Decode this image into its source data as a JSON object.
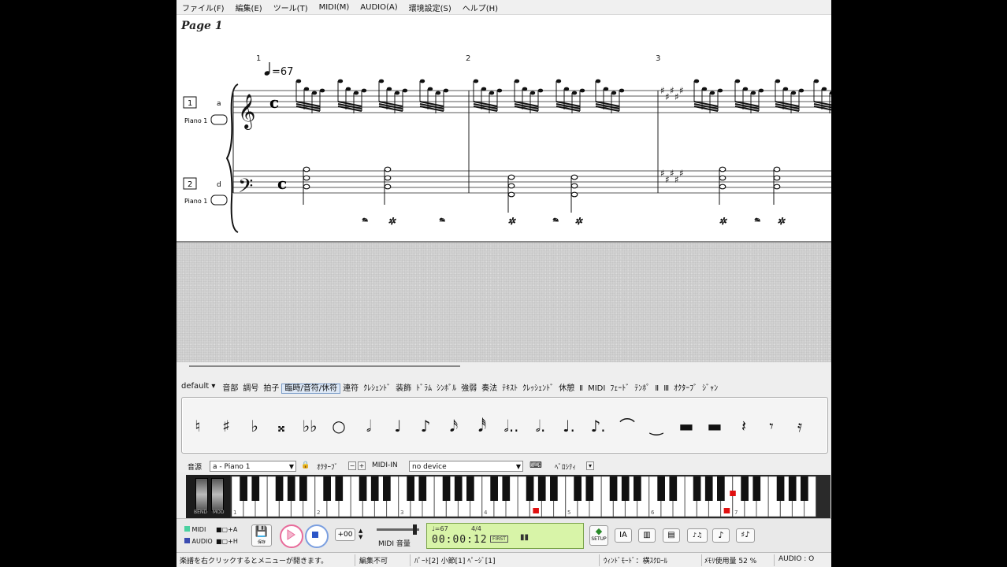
{
  "menu": [
    "ファイル(F)",
    "編集(E)",
    "ツール(T)",
    "MIDI(M)",
    "AUDIO(A)",
    "環境設定(S)",
    "ヘルプ(H)"
  ],
  "score": {
    "page_label": "Page 1",
    "tempo": "=67",
    "measure_numbers": [
      "1",
      "2",
      "3"
    ],
    "staves": [
      {
        "number": "1",
        "key_label": "a",
        "instrument": "Piano 1"
      },
      {
        "number": "2",
        "key_label": "d",
        "instrument": "Piano 1"
      }
    ],
    "time_signature": "c"
  },
  "palette": {
    "preset": "default",
    "tabs": [
      "音部",
      "調号",
      "拍子",
      "臨時/音符/休符",
      "連符",
      "ｸﾚｼｪﾝﾄﾞ",
      "装飾",
      "ﾄﾞﾗﾑ",
      "ｼﾝﾎﾞﾙ",
      "強弱",
      "奏法",
      "ﾃｷｽﾄ",
      "ｸﾚｯｼｪﾝﾄﾞ",
      "休憩",
      "Ⅱ",
      "MIDI",
      "ﾌｪｰﾄﾞ",
      "ﾃﾝﾎﾟ",
      "Ⅱ",
      "Ⅲ",
      "ｵｸﾀｰﾌﾞ",
      "ｼﾞｬﾝ"
    ],
    "active_tab_index": 3,
    "symbols": [
      "♮",
      "♯",
      "♭",
      "𝄪",
      "♭♭",
      "○",
      "𝅗𝅥",
      "♩",
      "♪",
      "𝅘𝅥𝅯",
      "𝅘𝅥𝅰",
      "𝅗𝅥..",
      "𝅗𝅥.",
      "♩.",
      "♪.",
      "⌒",
      "‿",
      "▬",
      "▬",
      "𝄽",
      "𝄾",
      "𝄿"
    ]
  },
  "instrument_row": {
    "label_part": "音源",
    "part_value": "a - Piano 1",
    "label_octave": "ｵｸﾀｰﾌﾞ",
    "label_midi_in": "MIDI-IN",
    "midi_in_value": "no device",
    "label_velocity": "ﾍﾞﾛｼﾃｨ"
  },
  "keyboard": {
    "bend_label": "BEND",
    "mod_label": "MOD",
    "octave_labels": [
      "1",
      "2",
      "3",
      "4",
      "5",
      "6",
      "7"
    ],
    "pressed_keys": [
      25,
      41,
      41.5,
      69
    ]
  },
  "transport": {
    "midi_label": "MIDI",
    "audio_label": "AUDIO",
    "midi_ab": "A",
    "audio_ab": "H",
    "save_label": "保存",
    "transpose_value": "+00",
    "volume_label": "MIDI 音量",
    "lcd_tempo": "♩=67",
    "lcd_sig": "4/4",
    "lcd_time": "00:00:12",
    "lcd_first": "FIRST",
    "setup_label": "SETUP"
  },
  "status": {
    "hint": "楽譜を右クリックするとメニューが開きます。",
    "edit": "編集不可",
    "position": "ﾊﾟｰﾄ[2] 小節[1] ﾍﾟｰｼﾞ[1]",
    "mode": "ｳｨﾝﾄﾞﾓｰﾄﾞ：横ｽｸﾛｰﾙ",
    "memory": "ﾒﾓﾘ使用量 52 %",
    "audio": "AUDIO : O"
  },
  "colors": {
    "pressed_key": "#e01010",
    "lcd": "#d8f4a8",
    "play": "#e86b9a",
    "stop": "#7b9fe0"
  }
}
